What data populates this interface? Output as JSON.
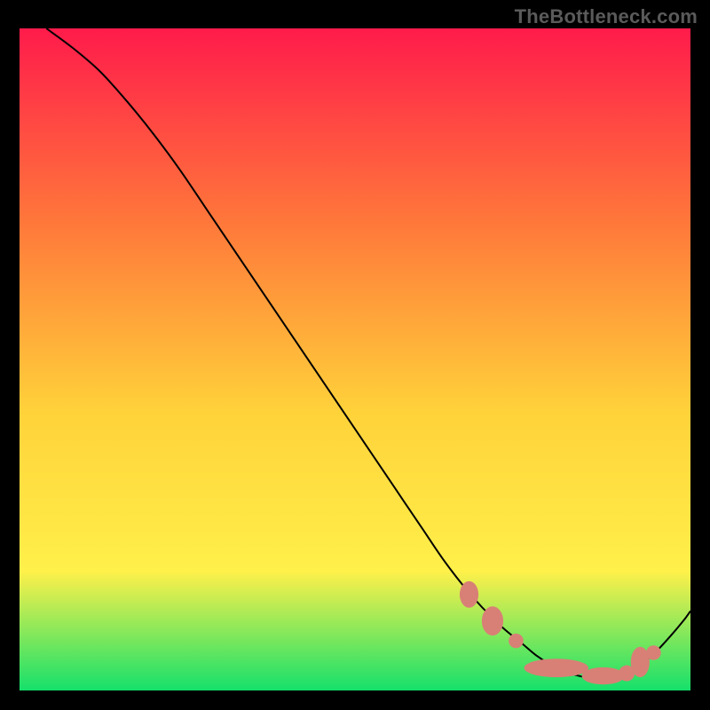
{
  "watermark": {
    "text": "TheBottleneck.com"
  },
  "colors": {
    "gradient_top": "#ff1b4b",
    "gradient_mid_a": "#ff7a3a",
    "gradient_mid_b": "#ffd23a",
    "gradient_mid_c": "#fff04a",
    "gradient_bottom": "#15e06b",
    "curve": "#000000",
    "marker": "#d88076",
    "frame": "#000000"
  },
  "chart_data": {
    "type": "line",
    "title": "",
    "xlabel": "",
    "ylabel": "",
    "xlim": [
      0,
      100
    ],
    "ylim": [
      0,
      100
    ],
    "grid": false,
    "series": [
      {
        "name": "bottleneck-curve",
        "x": [
          4,
          8,
          12,
          16,
          20,
          24,
          28,
          32,
          36,
          40,
          44,
          48,
          52,
          56,
          60,
          63,
          66,
          69,
          72,
          75,
          77,
          79,
          81,
          83,
          85,
          87,
          89,
          91,
          93,
          95,
          97,
          99,
          100
        ],
        "y": [
          100,
          97,
          93.5,
          89,
          84,
          78.5,
          72.5,
          66.5,
          60.5,
          54.5,
          48.5,
          42.5,
          36.5,
          30.5,
          24.5,
          20,
          16,
          12.5,
          9.5,
          7,
          5.3,
          4,
          3,
          2.3,
          1.9,
          1.8,
          2,
          2.8,
          4.2,
          6,
          8.2,
          10.6,
          12
        ]
      }
    ],
    "annotations": [
      {
        "kind": "marker",
        "shape": "ellipse",
        "x": 67,
        "y": 14.5,
        "rx": 1.4,
        "ry": 2.0
      },
      {
        "kind": "marker",
        "shape": "ellipse",
        "x": 70.5,
        "y": 10.5,
        "rx": 1.6,
        "ry": 2.2
      },
      {
        "kind": "marker",
        "shape": "circle",
        "x": 74,
        "y": 7.5,
        "r": 1.1
      },
      {
        "kind": "marker",
        "shape": "ellipse",
        "x": 80,
        "y": 3.4,
        "rx": 4.8,
        "ry": 1.4
      },
      {
        "kind": "marker",
        "shape": "ellipse",
        "x": 87,
        "y": 2.2,
        "rx": 3.2,
        "ry": 1.3
      },
      {
        "kind": "marker",
        "shape": "circle",
        "x": 90.5,
        "y": 2.6,
        "r": 1.2
      },
      {
        "kind": "marker",
        "shape": "ellipse",
        "x": 92.5,
        "y": 4.3,
        "rx": 1.4,
        "ry": 2.3
      },
      {
        "kind": "marker",
        "shape": "circle",
        "x": 94.5,
        "y": 5.7,
        "r": 1.1
      }
    ]
  }
}
